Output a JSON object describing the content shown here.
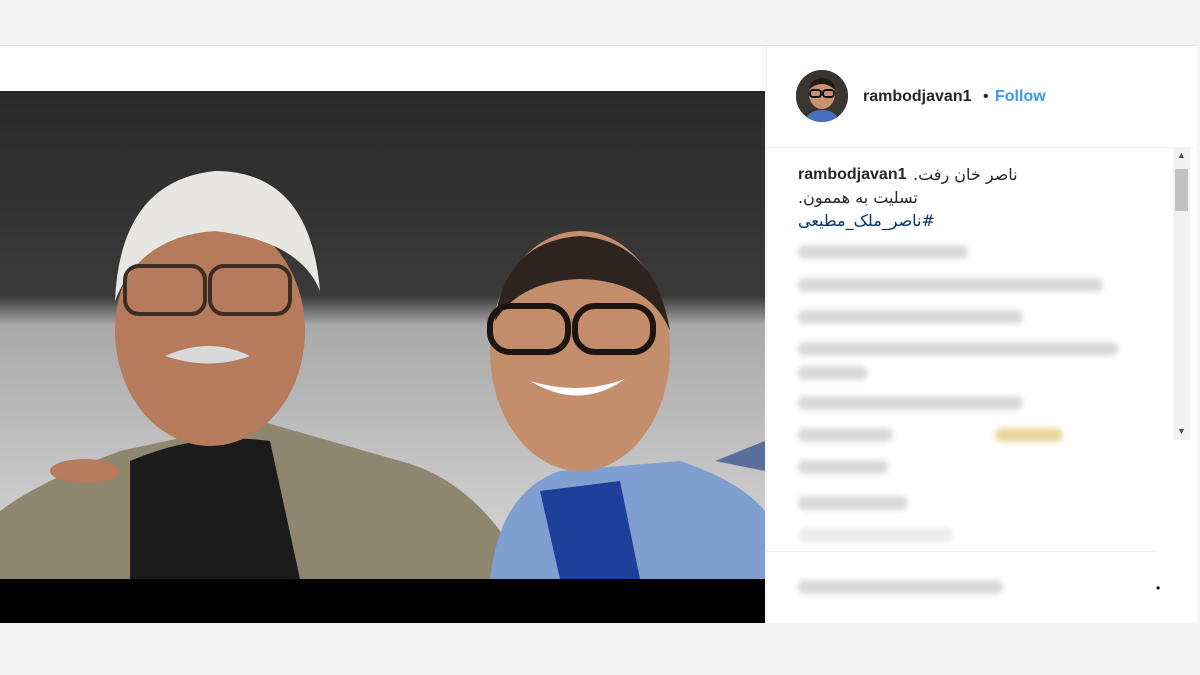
{
  "post": {
    "username": "rambodjavan1",
    "separator": "•",
    "follow_label": "Follow",
    "caption": {
      "username": "rambodjavan1",
      "line1": "ناصر خان رفت.",
      "line2": "تسلیت به هممون.",
      "hashtag": "#ناصر_ملک_مطیعی"
    },
    "more_icon": "•"
  },
  "colors": {
    "accent": "#3897f0",
    "hashtag": "#003569"
  }
}
